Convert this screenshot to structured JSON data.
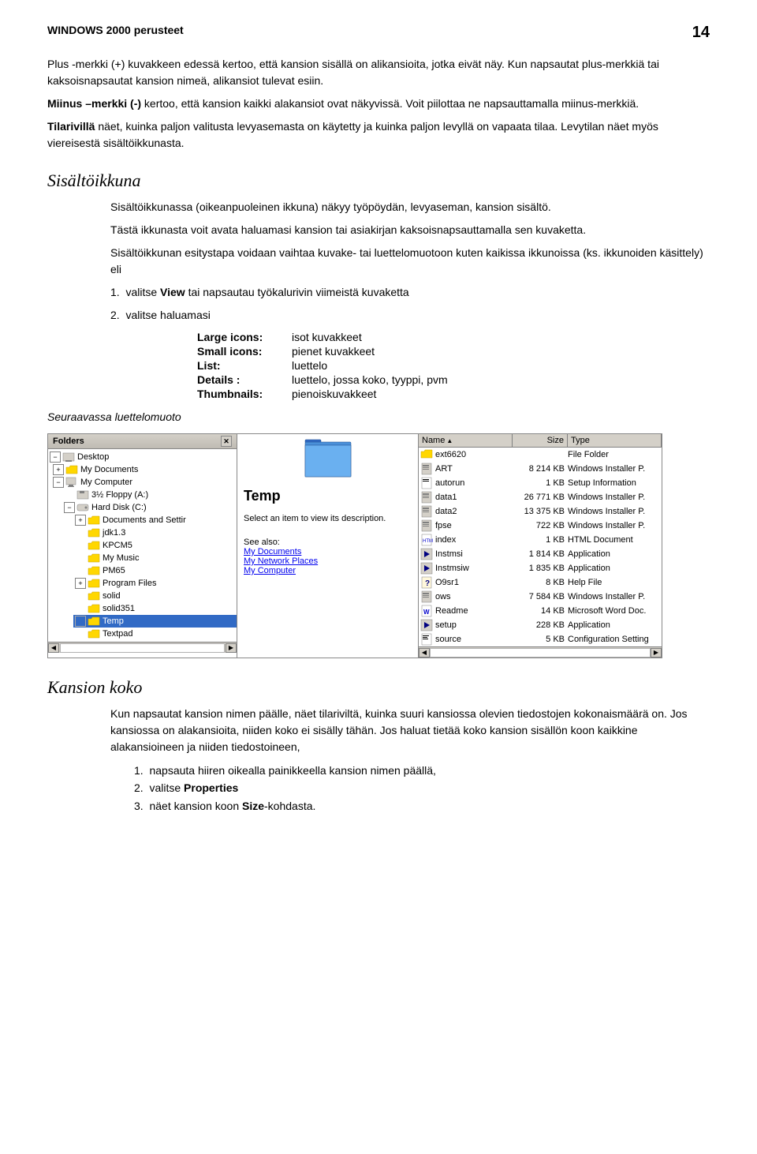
{
  "header": {
    "title": "WINDOWS 2000 perusteet",
    "page_number": "14"
  },
  "paragraphs": {
    "p1": "Plus -merkki (+) kuvakkeen edessä kertoo, että kansion sisällä on alikansioita, jotka eivät näy. Kun napsautat plus-merkkiä tai kaksoisnapsautat kansion nimeä, alikansiot tulevat esiin.",
    "p2_bold": "Miinus –merkki (-)",
    "p2_rest": " kertoo, että kansion kaikki alakansiot ovat näkyvissä. Voit piilottaa ne napsauttamalla miinus-merkkiä.",
    "p3_bold": "Tilarivillä",
    "p3_rest": " näet, kuinka paljon valitusta levyasemasta  on käytetty ja kuinka paljon levyllä on vapaata tilaa. Levytilan näet myös viereisestä sisältöikkunasta."
  },
  "section1": {
    "heading": "Sisältöikkuna",
    "p1": "Sisältöikkunassa (oikeanpuoleinen ikkuna) näkyy työpöydän, levyaseman, kansion sisältö.",
    "p2": "Tästä ikkunasta voit avata haluamasi kansion tai asiakirjan kaksoisnapsauttamalla sen kuvaketta.",
    "p3": "Sisältöikkunan esitystapa voidaan vaihtaa kuvake- tai luettelomuotoon kuten kaikissa ikkunoissa (ks. ikkunoiden käsittely) eli",
    "list_intro": "1.  valitse ",
    "list1_bold": "View",
    "list1_rest": " tai napsautau työkalurivin viimeistä kuvaketta",
    "list2": "2.  valitse haluamasi",
    "view_options": [
      {
        "label": "Large icons:",
        "value": "isot kuvakkeet"
      },
      {
        "label": "Small icons:",
        "value": "pienet kuvakkeet"
      },
      {
        "label": "List:",
        "value": "luettelo"
      },
      {
        "label": "Details :",
        "value": "luettelo, jossa koko, tyyppi, pvm"
      },
      {
        "label": "Thumbnails:",
        "value": "pienoiskuvakkeet"
      }
    ]
  },
  "screenshot_label": "Seuraavassa luettelomuoto",
  "explorer": {
    "folders_header": "Folders",
    "close_btn": "✕",
    "tree": [
      {
        "level": 0,
        "expander": "-",
        "label": "Desktop",
        "icon": "desktop",
        "indent": 0
      },
      {
        "level": 1,
        "expander": "+",
        "label": "My Documents",
        "icon": "folder",
        "indent": 1
      },
      {
        "level": 1,
        "expander": "-",
        "label": "My Computer",
        "icon": "computer",
        "indent": 1
      },
      {
        "level": 2,
        "expander": " ",
        "label": "3½ Floppy (A:)",
        "icon": "drive",
        "indent": 2
      },
      {
        "level": 2,
        "expander": "-",
        "label": "Hard Disk (C:)",
        "icon": "drive",
        "indent": 2
      },
      {
        "level": 3,
        "expander": "+",
        "label": "Documents and Settir",
        "icon": "folder",
        "indent": 3
      },
      {
        "level": 3,
        "expander": " ",
        "label": "jdk1.3",
        "icon": "folder",
        "indent": 3
      },
      {
        "level": 3,
        "expander": " ",
        "label": "KPCM5",
        "icon": "folder",
        "indent": 3
      },
      {
        "level": 3,
        "expander": " ",
        "label": "My Music",
        "icon": "folder",
        "indent": 3
      },
      {
        "level": 3,
        "expander": " ",
        "label": "PM65",
        "icon": "folder",
        "indent": 3
      },
      {
        "level": 3,
        "expander": "+",
        "label": "Program Files",
        "icon": "folder",
        "indent": 3
      },
      {
        "level": 3,
        "expander": " ",
        "label": "solid",
        "icon": "folder",
        "indent": 3
      },
      {
        "level": 3,
        "expander": " ",
        "label": "solid351",
        "icon": "folder",
        "indent": 3
      },
      {
        "level": 3,
        "expander": " ",
        "label": "Temp",
        "icon": "folder_selected",
        "indent": 3
      },
      {
        "level": 3,
        "expander": " ",
        "label": "Textpad",
        "icon": "folder",
        "indent": 3
      }
    ],
    "preview": {
      "folder_name": "Temp",
      "select_text": "Select an item to view its description.",
      "see_also_label": "See also:",
      "links": [
        "My Documents",
        "My Network Places",
        "My Computer"
      ]
    },
    "files": {
      "columns": [
        "Name",
        "Size",
        "Type"
      ],
      "sort_col": "Name",
      "rows": [
        {
          "name": "ext6620",
          "size": "",
          "type": "File Folder",
          "icon": "folder"
        },
        {
          "name": "ART",
          "size": "8 214 KB",
          "type": "Windows Installer P.",
          "icon": "installer"
        },
        {
          "name": "autorun",
          "size": "1 KB",
          "type": "Setup Information",
          "icon": "setup"
        },
        {
          "name": "data1",
          "size": "26 771 KB",
          "type": "Windows Installer P.",
          "icon": "installer"
        },
        {
          "name": "data2",
          "size": "13 375 KB",
          "type": "Windows Installer P.",
          "icon": "installer"
        },
        {
          "name": "fpse",
          "size": "722 KB",
          "type": "Windows Installer P.",
          "icon": "installer"
        },
        {
          "name": "index",
          "size": "1 KB",
          "type": "HTML Document",
          "icon": "html"
        },
        {
          "name": "Instmsi",
          "size": "1 814 KB",
          "type": "Application",
          "icon": "exe"
        },
        {
          "name": "Instmsiw",
          "size": "1 835 KB",
          "type": "Application",
          "icon": "exe"
        },
        {
          "name": "O9sr1",
          "size": "8 KB",
          "type": "Help File",
          "icon": "help"
        },
        {
          "name": "ows",
          "size": "7 584 KB",
          "type": "Windows Installer P.",
          "icon": "installer"
        },
        {
          "name": "Readme",
          "size": "14 KB",
          "type": "Microsoft Word Doc.",
          "icon": "word"
        },
        {
          "name": "setup",
          "size": "228 KB",
          "type": "Application",
          "icon": "exe"
        },
        {
          "name": "source",
          "size": "5 KB",
          "type": "Configuration Setting",
          "icon": "config"
        }
      ]
    }
  },
  "section2": {
    "heading": "Kansion koko",
    "p1": "Kun napsautat kansion nimen päälle, näet tilariviltä, kuinka suuri kansiossa olevien tiedostojen kokonaismäärä on. Jos kansiossa on alakansioita, niiden koko ei sisälly tähän. Jos haluat tietää koko kansion sisällön koon kaikkine alakansioineen ja niiden tiedostoineen,",
    "list": [
      {
        "num": "1.",
        "text": "napsauta hiiren oikealla painikkeella kansion nimen päällä,"
      },
      {
        "num": "2.",
        "text": "valitse ",
        "bold_part": "Properties"
      },
      {
        "num": "3.",
        "text": "näet kansion koon ",
        "bold_part": "Size",
        "rest_part": "-kohdasta."
      }
    ]
  }
}
